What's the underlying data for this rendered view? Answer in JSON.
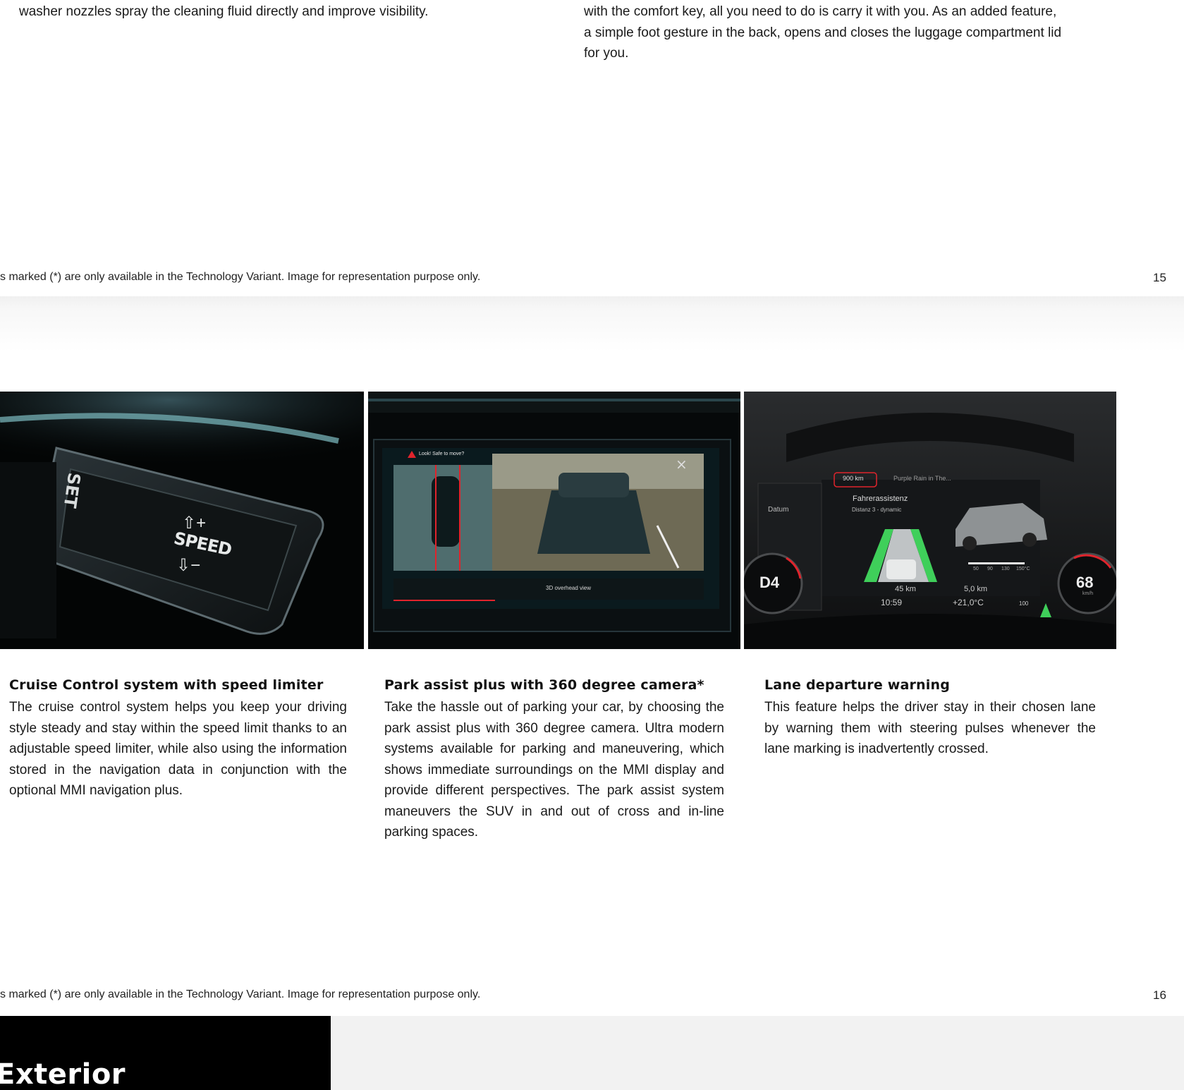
{
  "page15": {
    "left_text": "washer nozzles spray the cleaning fluid directly and improve visibility.",
    "right_text_lines": [
      "with the comfort key, all you need to do is carry it with you. As an added feature,",
      "a simple foot gesture in the back, opens and closes the luggage compartment lid",
      "for you."
    ],
    "footnote": "s marked (*) are only available in the Technology Variant. Image for representation purpose only.",
    "page_number": "15"
  },
  "page16": {
    "photos": {
      "cruise": {
        "set_label": "SET",
        "speed_label": "SPEED"
      },
      "park": {
        "warning_text": "Look! Safe to move?",
        "view_label": "3D overhead view"
      },
      "cluster": {
        "range": "900 km",
        "media": "Purple Rain in The...",
        "datum": "Datum",
        "menu_title": "Fahrerassistenz",
        "menu_sub": "Distanz 3 - dynamic",
        "gear": "D4",
        "speed": "68",
        "speed_unit": "km/h",
        "trip1": "45 km",
        "trip2": "5,0 km",
        "clock": "10:59",
        "temp": "+21,0°C",
        "limit": "100",
        "temp_scale": [
          "50",
          "90",
          "130",
          "150°C"
        ]
      }
    },
    "columns": [
      {
        "heading": "Cruise Control system with speed limiter",
        "body": "The cruise control system helps you keep your driving style steady and stay within the speed limit thanks to an adjustable speed limiter, while also using the information stored in the navigation data in conjunction with the optional MMI navigation plus."
      },
      {
        "heading": "Park assist plus with 360 degree camera*",
        "body": "Take the hassle out of parking your car, by choosing the park assist plus with 360 degree camera. Ultra modern systems available for parking and maneuvering, which shows immediate surroundings on the MMI display and provide different perspectives. The park assist system maneuvers the SUV in and out of cross and in-line parking spaces."
      },
      {
        "heading": "Lane departure warning",
        "body": "This feature helps the driver stay in their chosen lane by warning them with steering pulses whenever the lane marking is inadvertently crossed."
      }
    ],
    "footnote": "s marked (*) are only available in the Technology Variant. Image for representation purpose only.",
    "page_number": "16"
  },
  "page17": {
    "section_title": "Exterior"
  },
  "colors": {
    "accent_green": "#3fcf5a",
    "warning_red": "#e0242c",
    "page_bg": "#ffffff",
    "gap_bg": "#f2f2f2"
  }
}
